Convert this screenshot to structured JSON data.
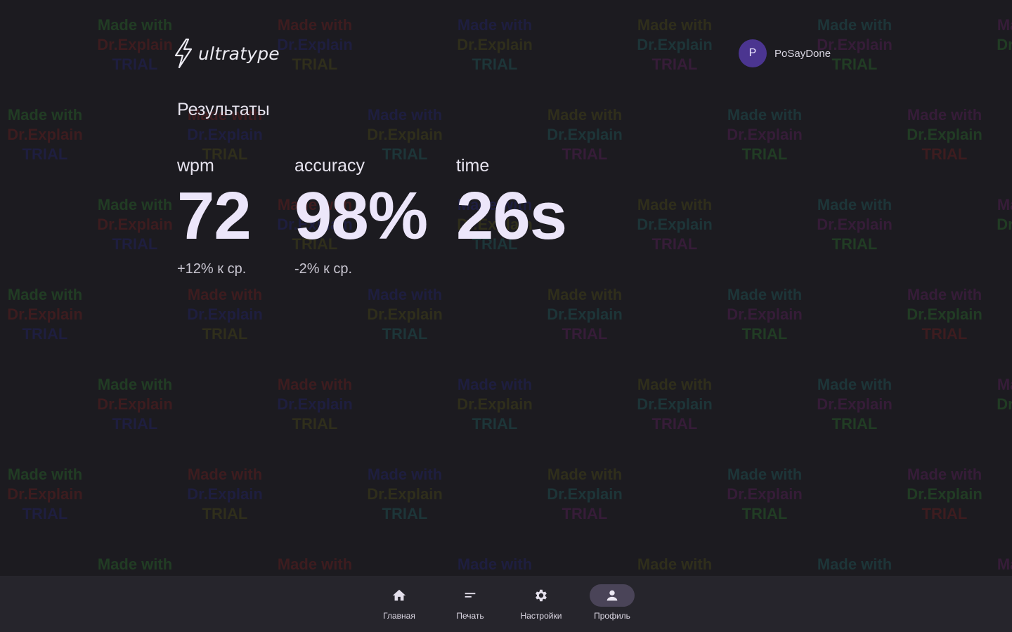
{
  "header": {
    "logo_text": "ultratype",
    "user": {
      "initial": "P",
      "name": "PoSayDone"
    }
  },
  "results": {
    "title": "Результаты",
    "stats": [
      {
        "label": "wpm",
        "value": "72",
        "delta": "+12% к ср."
      },
      {
        "label": "accuracy",
        "value": "98%",
        "delta": "-2% к ср."
      },
      {
        "label": "time",
        "value": "26s",
        "delta": ""
      }
    ]
  },
  "nav": {
    "items": [
      {
        "label": "Главная",
        "icon": "home-icon",
        "active": false
      },
      {
        "label": "Печать",
        "icon": "short-text-icon",
        "active": false
      },
      {
        "label": "Настройки",
        "icon": "gear-icon",
        "active": false
      },
      {
        "label": "Профиль",
        "icon": "person-icon",
        "active": true
      }
    ]
  },
  "watermark": {
    "lines": [
      "Made with",
      "Dr.Explain",
      "TRIAL"
    ]
  },
  "colors": {
    "background": "#1c1b20",
    "navbar": "#26252c",
    "avatar": "#4b3590",
    "active_pill": "#4a4458"
  }
}
